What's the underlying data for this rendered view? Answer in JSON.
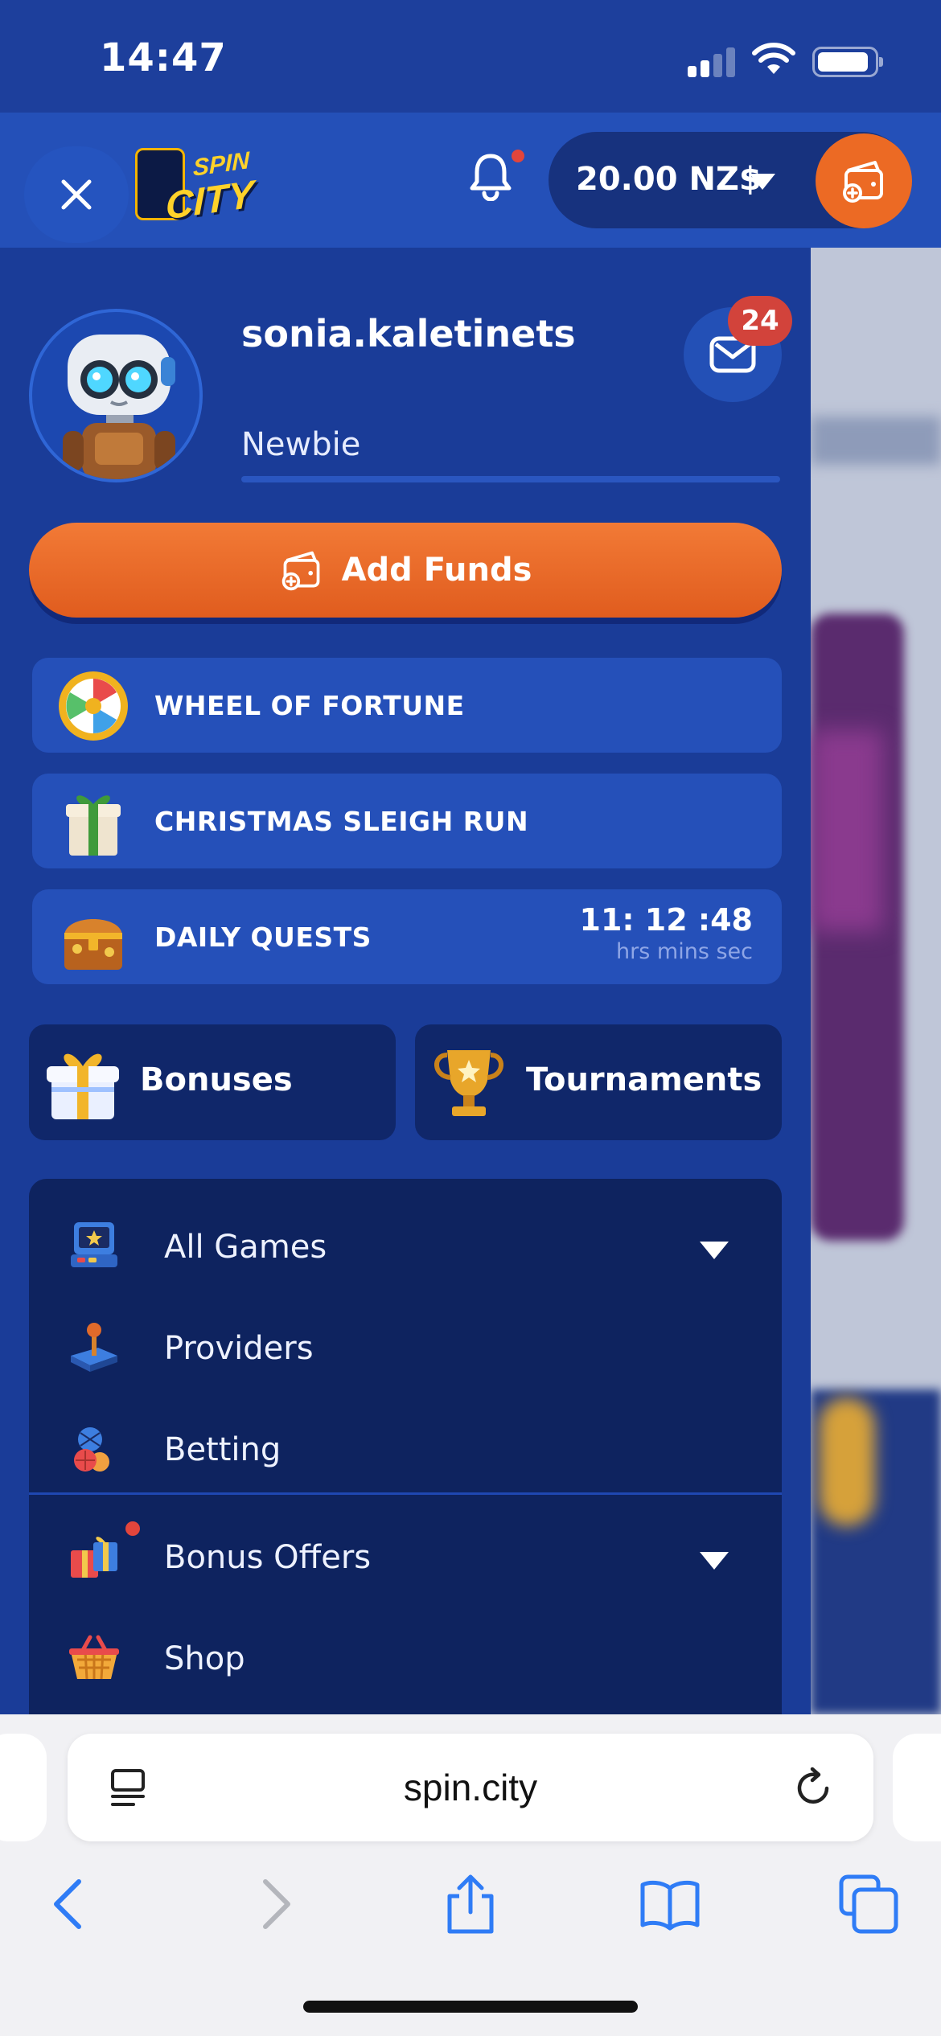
{
  "status_bar": {
    "time": "14:47"
  },
  "header": {
    "close_label": "×",
    "logo_top": "SPIN",
    "logo_bottom": "CITY",
    "balance": "20.00 NZ$"
  },
  "profile": {
    "username": "sonia.kaletinets",
    "rank": "Newbie",
    "mail_count": "24"
  },
  "add_funds_label": "Add Funds",
  "promos": [
    {
      "label": "WHEEL OF FORTUNE",
      "icon": "wheel-of-fortune-icon"
    },
    {
      "label": "CHRISTMAS SLEIGH RUN",
      "icon": "gift-box-icon"
    },
    {
      "label": "DAILY QUESTS",
      "icon": "treasure-chest-icon"
    }
  ],
  "timer": {
    "value": "11: 12 :48",
    "units": "hrs mins sec"
  },
  "quick_links": [
    {
      "label": "Bonuses",
      "icon": "gift-icon"
    },
    {
      "label": "Tournaments",
      "icon": "trophy-icon"
    }
  ],
  "menu": [
    {
      "label": "All Games",
      "icon": "arcade-icon",
      "expandable": true
    },
    {
      "label": "Providers",
      "icon": "joystick-icon",
      "expandable": false
    },
    {
      "label": "Betting",
      "icon": "sports-balls-icon",
      "expandable": false
    },
    {
      "label": "Bonus Offers",
      "icon": "gift-boxes-icon",
      "expandable": true
    },
    {
      "label": "Shop",
      "icon": "shopping-basket-icon",
      "expandable": false
    }
  ],
  "browser": {
    "url": "spin.city"
  },
  "colors": {
    "panel_bg": "#1a3c98",
    "header_bg": "#2450b8",
    "accent_orange": "#ec6a24",
    "menu_bg": "#0e235f",
    "badge_red": "#d2433b"
  }
}
